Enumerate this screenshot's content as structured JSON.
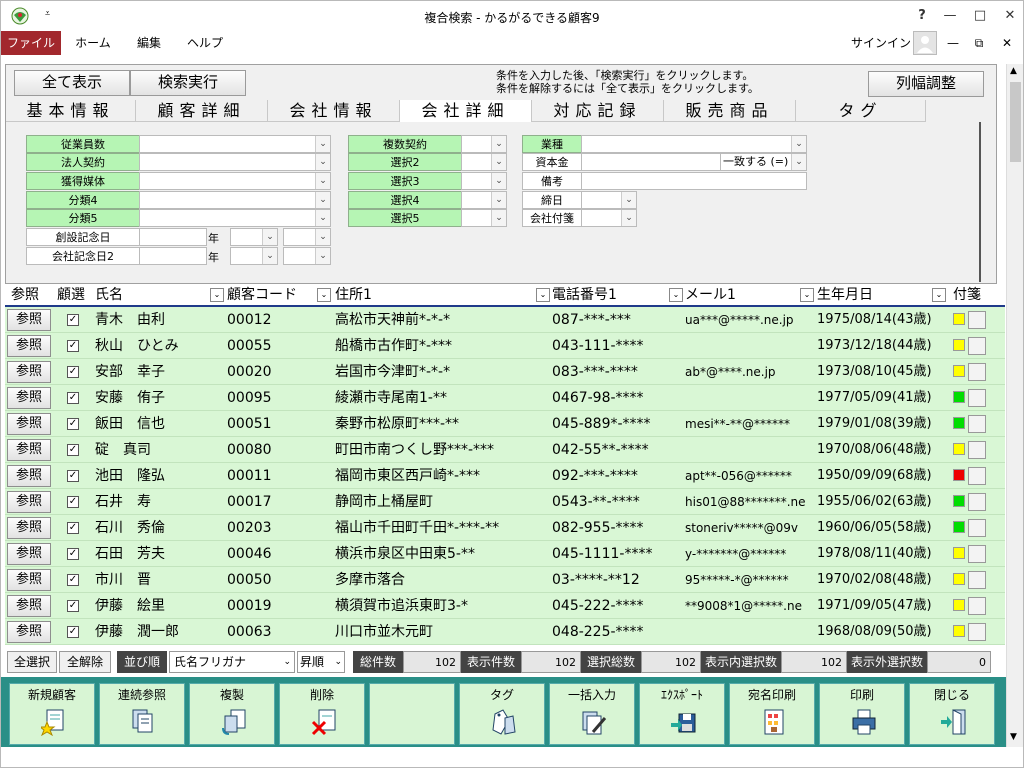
{
  "window": {
    "title": "複合検索 - かるがるできる顧客9",
    "help_symbol": "?",
    "minimize_symbol": "—",
    "maximize_symbol": "□",
    "close_symbol": "✕"
  },
  "ribbon": {
    "file_tab": "ファイル",
    "tabs": [
      "ホーム",
      "編集",
      "ヘルプ"
    ],
    "signin": "サインイン",
    "restore_symbol": "⧉"
  },
  "form": {
    "show_all_button": "全て表示",
    "search_button": "検索実行",
    "hint_line1": "条件を入力した後、「検索実行」をクリックします。",
    "hint_line2": "条件を解除するには「全て表示」をクリックします。",
    "column_width_button": "列幅調整",
    "tabs": [
      "基本情報",
      "顧客詳細",
      "会社情報",
      "会社詳細",
      "対応記録",
      "販売商品",
      "タグ"
    ],
    "active_tab_index": 3,
    "left_fields": [
      "従業員数",
      "法人契約",
      "獲得媒体",
      "分類4",
      "分類5"
    ],
    "date_fields": [
      "創設記念日",
      "会社記念日2"
    ],
    "year_label": "年",
    "middle_fields": [
      "複数契約",
      "選択2",
      "選択3",
      "選択4",
      "選択5"
    ],
    "right_fields": [
      "業種",
      "資本金",
      "備考",
      "締日",
      "会社付箋"
    ],
    "capital_match": "一致する (=)"
  },
  "grid": {
    "headers": [
      "参照",
      "顧選",
      "氏名",
      "顧客コード",
      "住所1",
      "電話番号1",
      "メール1",
      "生年月日",
      "付箋"
    ],
    "ref_label": "参照",
    "rows": [
      {
        "name": "青木　由利",
        "code": "00012",
        "address": "高松市天神前*-*-*",
        "phone": "087-***-***",
        "email": "ua***@*****.ne.jp",
        "birth": "1975/08/14(43歳)",
        "tag": "#ffff00"
      },
      {
        "name": "秋山　ひとみ",
        "code": "00055",
        "address": "船橋市古作町*-***",
        "phone": "043-111-****",
        "email": "",
        "birth": "1973/12/18(44歳)",
        "tag": "#ffff00"
      },
      {
        "name": "安部　幸子",
        "code": "00020",
        "address": "岩国市今津町*-*-*",
        "phone": "083-***-****",
        "email": "ab*@****.ne.jp",
        "birth": "1973/08/10(45歳)",
        "tag": "#ffff00"
      },
      {
        "name": "安藤　侑子",
        "code": "00095",
        "address": "綾瀬市寺尾南1-**",
        "phone": "0467-98-****",
        "email": "",
        "birth": "1977/05/09(41歳)",
        "tag": "#00dd00"
      },
      {
        "name": "飯田　信也",
        "code": "00051",
        "address": "秦野市松原町***-**",
        "phone": "045-889*-****",
        "email": "mesi**-**@******",
        "birth": "1979/01/08(39歳)",
        "tag": "#00dd00"
      },
      {
        "name": "碇　真司",
        "code": "00080",
        "address": "町田市南つくし野***-***",
        "phone": "042-55**-****",
        "email": "",
        "birth": "1970/08/06(48歳)",
        "tag": "#ffff00"
      },
      {
        "name": "池田　隆弘",
        "code": "00011",
        "address": "福岡市東区西戸崎*-***",
        "phone": "092-***-****",
        "email": "apt**-056@******",
        "birth": "1950/09/09(68歳)",
        "tag": "#ee0000"
      },
      {
        "name": "石井　寿",
        "code": "00017",
        "address": "静岡市上桶屋町",
        "phone": "0543-**-****",
        "email": "his01@88*******.ne",
        "birth": "1955/06/02(63歳)",
        "tag": "#00dd00"
      },
      {
        "name": "石川　秀倫",
        "code": "00203",
        "address": "福山市千田町千田*-***-**",
        "phone": "082-955-****",
        "email": "stoneriv*****@09v",
        "birth": "1960/06/05(58歳)",
        "tag": "#00dd00"
      },
      {
        "name": "石田　芳夫",
        "code": "00046",
        "address": "横浜市泉区中田東5-**",
        "phone": "045-1111-****",
        "email": "y-*******@******",
        "birth": "1978/08/11(40歳)",
        "tag": "#ffff00"
      },
      {
        "name": "市川　晋",
        "code": "00050",
        "address": "多摩市落合",
        "phone": "03-****-**12",
        "email": "95*****-*@******",
        "birth": "1970/02/08(48歳)",
        "tag": "#ffff00"
      },
      {
        "name": "伊藤　絵里",
        "code": "00019",
        "address": "横須賀市追浜東町3-*",
        "phone": "045-222-****",
        "email": "**9008*1@*****.ne",
        "birth": "1971/09/05(47歳)",
        "tag": "#ffff00"
      },
      {
        "name": "伊藤　潤一郎",
        "code": "00063",
        "address": "川口市並木元町",
        "phone": "048-225-****",
        "email": "",
        "birth": "1968/08/09(50歳)",
        "tag": "#ffff00"
      }
    ]
  },
  "status": {
    "select_all": "全選択",
    "deselect_all": "全解除",
    "sort_label": "並び順",
    "sort_field": "氏名フリガナ",
    "sort_order": "昇順",
    "total_label": "総件数",
    "total_value": "102",
    "shown_label": "表示件数",
    "shown_value": "102",
    "selected_label": "選択総数",
    "selected_value": "102",
    "in_view_label": "表示内選択数",
    "in_view_value": "102",
    "out_view_label": "表示外選択数",
    "out_view_value": "0"
  },
  "toolbar": {
    "buttons": [
      "新規顧客",
      "連続参照",
      "複製",
      "削除",
      "",
      "タグ",
      "一括入力",
      "ｴｸｽﾎﾟｰﾄ",
      "宛名印刷",
      "印刷",
      "閉じる"
    ]
  }
}
